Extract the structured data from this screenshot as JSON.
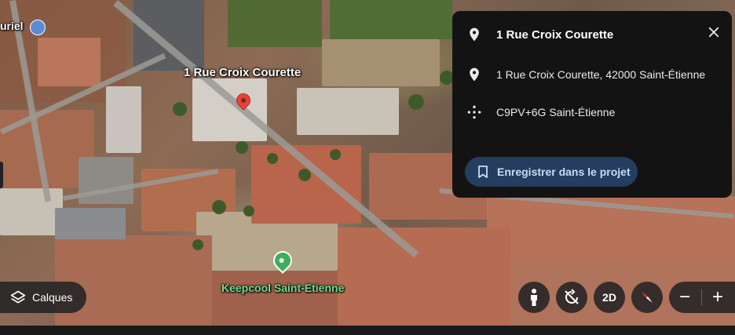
{
  "map": {
    "place_label": "1 Rue Croix Courette",
    "poi_label": "Keepcool Saint-Etienne",
    "corner_label": "uriel",
    "pin_color": "#ea4335",
    "poi_color": "#3fae5a"
  },
  "panel": {
    "title": "1 Rue Croix Courette",
    "address": "1 Rue Croix Courette, 42000 Saint-Étienne",
    "plus_code": "C9PV+6G Saint-Étienne",
    "save_label": "Enregistrer dans le projet",
    "icons": {
      "title": "location-pin-icon",
      "address": "location-pin-icon",
      "plus_code": "plus-code-icon",
      "close": "close-icon",
      "save": "bookmark-icon"
    }
  },
  "controls": {
    "layers_label": "Calques",
    "view_2d_label": "2D",
    "zoom_out_label": "−",
    "zoom_in_label": "+"
  },
  "colors": {
    "panel_bg": "#131314",
    "button_bg": "#253e5f",
    "button_text": "#c8dcf7"
  }
}
